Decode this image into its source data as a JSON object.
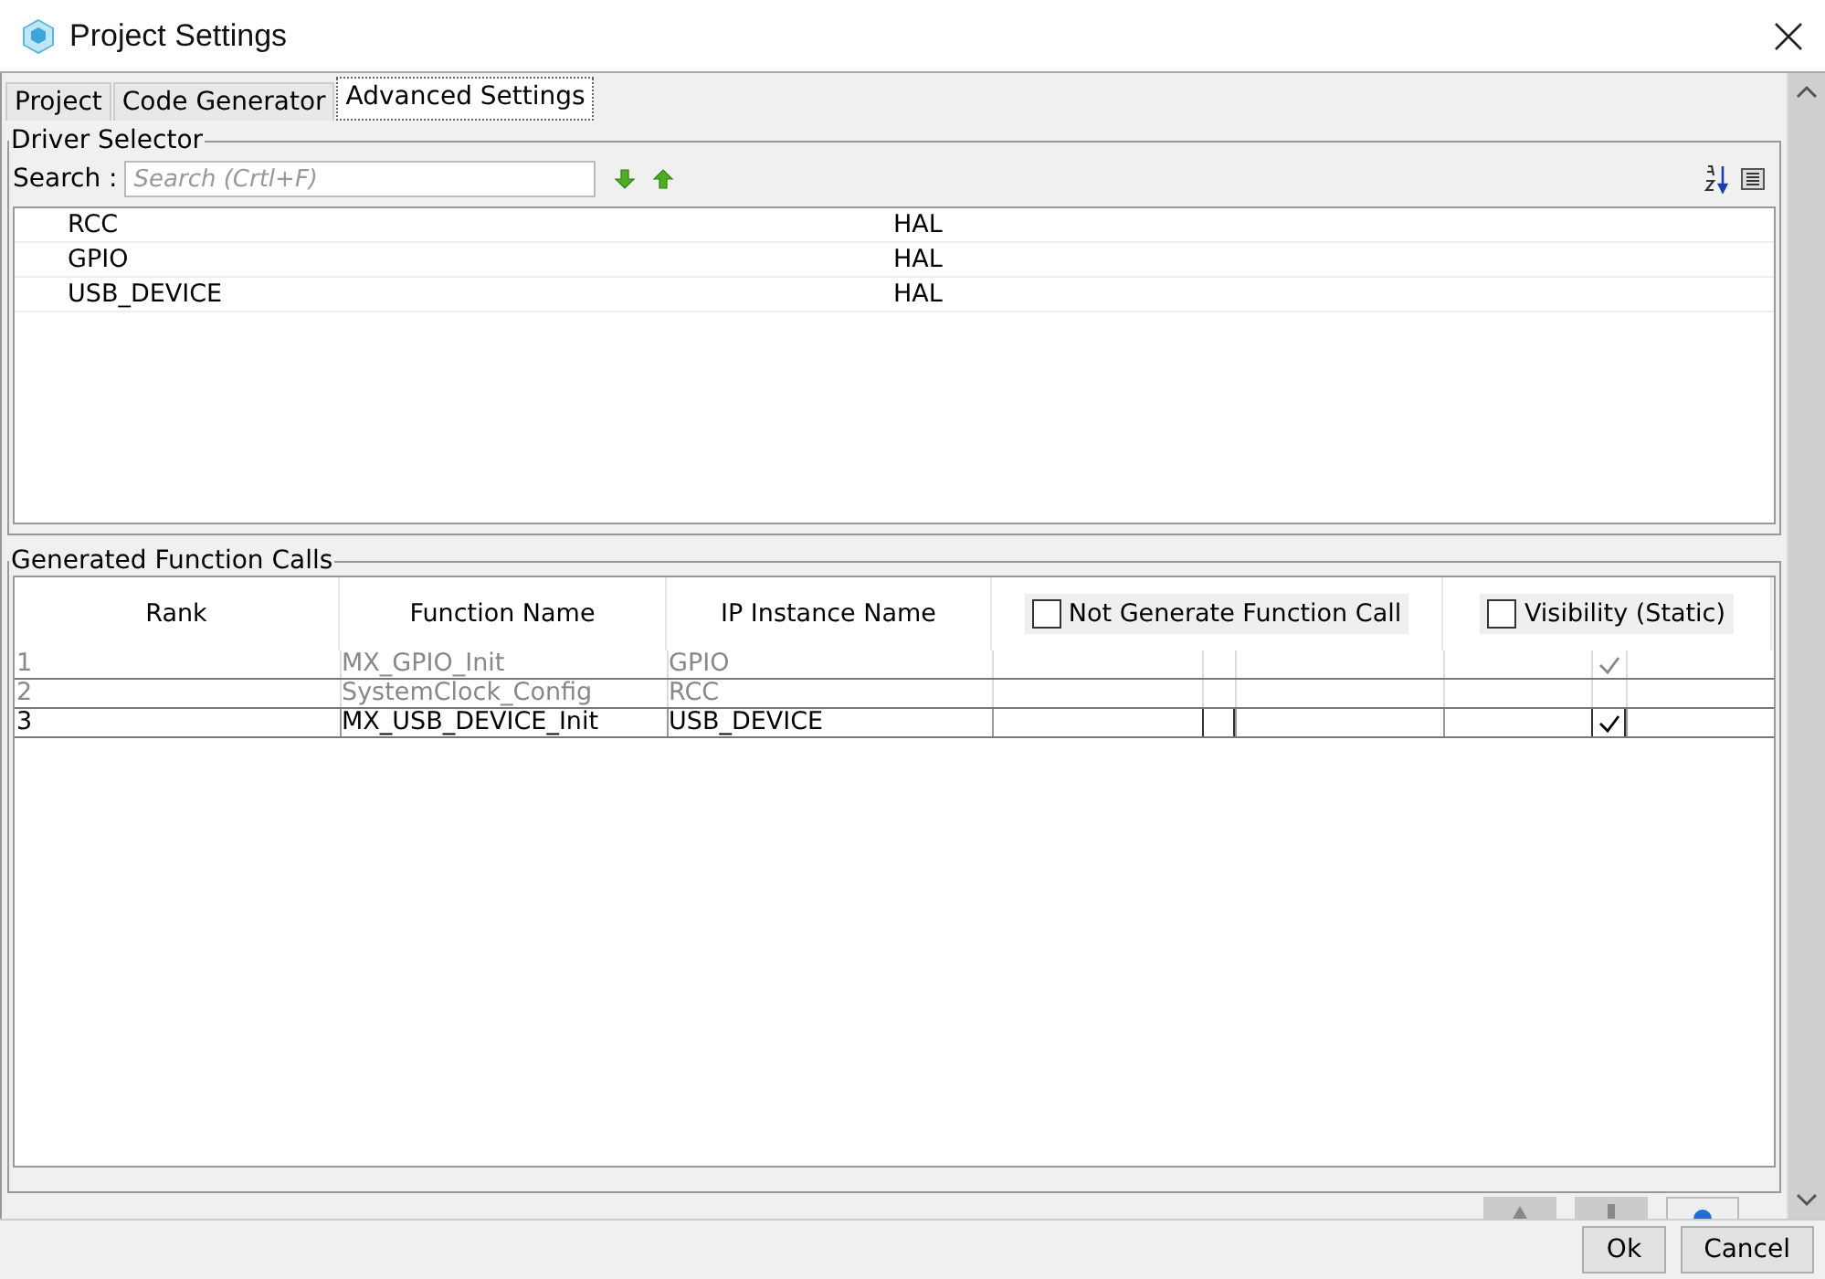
{
  "window": {
    "title": "Project Settings"
  },
  "tabs": [
    {
      "label": "Project",
      "selected": false
    },
    {
      "label": "Code Generator",
      "selected": false
    },
    {
      "label": "Advanced Settings",
      "selected": true
    }
  ],
  "driver_selector": {
    "title": "Driver Selector",
    "search_label": "Search :",
    "search": {
      "placeholder": "Search (Crtl+F)"
    },
    "rows": [
      {
        "name": "RCC",
        "driver": "HAL"
      },
      {
        "name": "GPIO",
        "driver": "HAL"
      },
      {
        "name": "USB_DEVICE",
        "driver": "HAL"
      }
    ]
  },
  "function_calls": {
    "title": "Generated Function Calls",
    "columns": {
      "rank": "Rank",
      "function": "Function Name",
      "instance": "IP Instance Name",
      "not_generate": {
        "label": "Not Generate Function Call",
        "checked": false
      },
      "visibility": {
        "label": "Visibility (Static)",
        "checked": false
      }
    },
    "rows": [
      {
        "rank": "1",
        "function": "MX_GPIO_Init",
        "instance": "GPIO",
        "disabled": true,
        "not_generate": false,
        "visibility": true
      },
      {
        "rank": "2",
        "function": "SystemClock_Config",
        "instance": "RCC",
        "disabled": true,
        "not_generate": false,
        "visibility": false
      },
      {
        "rank": "3",
        "function": "MX_USB_DEVICE_Init",
        "instance": "USB_DEVICE",
        "disabled": false,
        "not_generate": false,
        "visibility": true
      }
    ]
  },
  "buttons": [
    {
      "label": "Ok"
    },
    {
      "label": "Cancel"
    }
  ]
}
